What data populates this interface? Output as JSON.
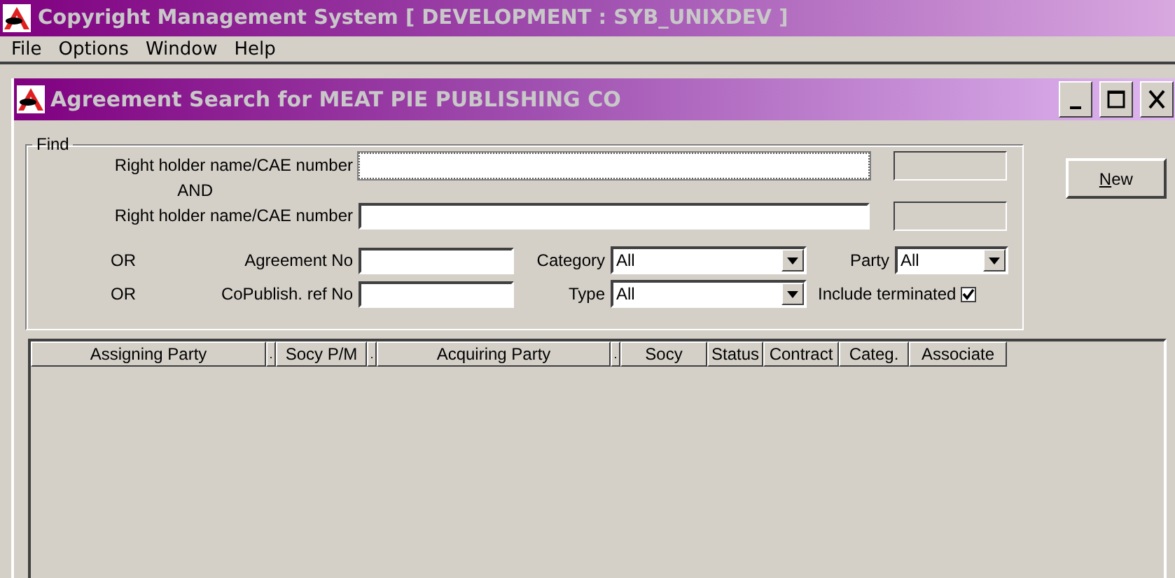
{
  "window": {
    "title": "Copyright Management System [ DEVELOPMENT : SYB_UNIXDEV ]"
  },
  "menu": [
    "File",
    "Options",
    "Window",
    "Help"
  ],
  "child_window": {
    "title": "Agreement Search for MEAT PIE PUBLISHING CO"
  },
  "find": {
    "label": "Find",
    "holders": [
      {
        "label": "Right holder name/CAE number",
        "focused": true
      },
      {
        "label": "Right holder name/CAE number",
        "focused": false
      }
    ],
    "and_label": "AND",
    "agreement": {
      "prefix": "OR",
      "label": "Agreement No"
    },
    "copublish": {
      "prefix": "OR",
      "label": "CoPublish. ref No"
    },
    "category": {
      "label": "Category",
      "value": "All"
    },
    "type": {
      "label": "Type",
      "value": "All"
    },
    "party": {
      "label": "Party",
      "value": "All"
    },
    "include_terminated": {
      "label": "Include terminated",
      "checked": true
    }
  },
  "new_button": {
    "label": "New"
  },
  "grid": {
    "columns": [
      {
        "label": "Assigning Party",
        "kind": "wide"
      },
      {
        "label": ".",
        "kind": "spacer"
      },
      {
        "label": "Socy P/M",
        "kind": "wide"
      },
      {
        "label": ".",
        "kind": "spacer"
      },
      {
        "label": "Acquiring Party",
        "kind": "wide"
      },
      {
        "label": ".",
        "kind": "spacer"
      },
      {
        "label": "Socy",
        "kind": "wide"
      },
      {
        "label": "Status",
        "kind": "wide"
      },
      {
        "label": "Contract",
        "kind": "wide"
      },
      {
        "label": "Categ.",
        "kind": "wide"
      },
      {
        "label": "Associate",
        "kind": "wide"
      }
    ]
  }
}
